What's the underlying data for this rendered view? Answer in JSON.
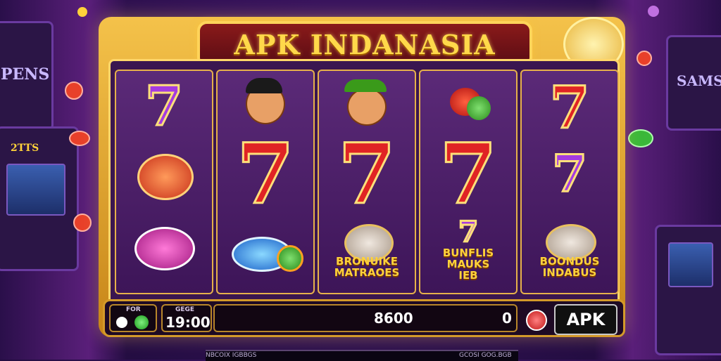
{
  "title": "APK INDANASIA",
  "reels": [
    {
      "symbols": [
        "purple-seven",
        "red-chips",
        "pink-chip"
      ]
    },
    {
      "symbols": [
        "character-face",
        "red-seven",
        "blue-chip"
      ]
    },
    {
      "symbols": [
        "character-face-hat",
        "red-seven",
        "bonus-coin"
      ],
      "bonus_text": "BRONUIKE\nMATRAOES"
    },
    {
      "symbols": [
        "fruit-cluster",
        "red-seven",
        "bonus-seven"
      ],
      "bonus_text": "BUNFLIS\nMAUKS\nIEB"
    },
    {
      "symbols": [
        "red-seven",
        "purple-seven",
        "bonus-coin"
      ],
      "bonus_text": "BOONDUS\nINDABUS"
    }
  ],
  "seven_glyph": "7",
  "controls": {
    "left_label": "FOR",
    "time_label": "GEGE",
    "time_value": "19:00",
    "credit_value": "8600",
    "bet_value": "0",
    "apk_button": "APK"
  },
  "footer": {
    "left_text": "NBCOIX IGBBGS",
    "right_text": "GCOSI GOG.BGB"
  },
  "side_signs": {
    "left": "PENS",
    "right": "SAMS",
    "left_machine": "2TTS"
  },
  "colors": {
    "frame_gold": "#f4c24a",
    "reel_bg": "#4a1d66",
    "seven_red": "#e02424",
    "seven_purple": "#a53be0",
    "bonus_gold": "#ffd23a"
  }
}
